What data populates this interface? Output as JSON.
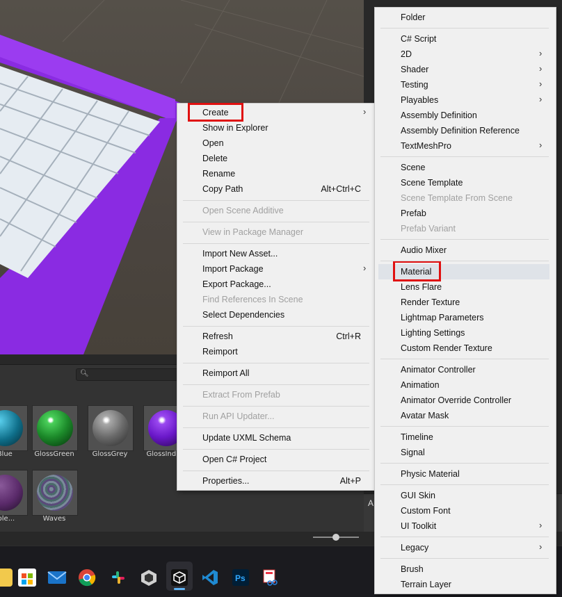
{
  "context_menu": {
    "items": [
      {
        "label": "Create",
        "shortcut": "",
        "submenu": true,
        "enabled": true
      },
      {
        "label": "Show in Explorer",
        "shortcut": "",
        "submenu": false,
        "enabled": true
      },
      {
        "label": "Open",
        "shortcut": "",
        "submenu": false,
        "enabled": true
      },
      {
        "label": "Delete",
        "shortcut": "",
        "submenu": false,
        "enabled": true
      },
      {
        "label": "Rename",
        "shortcut": "",
        "submenu": false,
        "enabled": true
      },
      {
        "label": "Copy Path",
        "shortcut": "Alt+Ctrl+C",
        "submenu": false,
        "enabled": true
      },
      {
        "label": "Open Scene Additive",
        "shortcut": "",
        "submenu": false,
        "enabled": false
      },
      {
        "label": "View in Package Manager",
        "shortcut": "",
        "submenu": false,
        "enabled": false
      },
      {
        "label": "Import New Asset...",
        "shortcut": "",
        "submenu": false,
        "enabled": true
      },
      {
        "label": "Import Package",
        "shortcut": "",
        "submenu": true,
        "enabled": true
      },
      {
        "label": "Export Package...",
        "shortcut": "",
        "submenu": false,
        "enabled": true
      },
      {
        "label": "Find References In Scene",
        "shortcut": "",
        "submenu": false,
        "enabled": false
      },
      {
        "label": "Select Dependencies",
        "shortcut": "",
        "submenu": false,
        "enabled": true
      },
      {
        "label": "Refresh",
        "shortcut": "Ctrl+R",
        "submenu": false,
        "enabled": true
      },
      {
        "label": "Reimport",
        "shortcut": "",
        "submenu": false,
        "enabled": true
      },
      {
        "label": "Reimport All",
        "shortcut": "",
        "submenu": false,
        "enabled": true
      },
      {
        "label": "Extract From Prefab",
        "shortcut": "",
        "submenu": false,
        "enabled": false
      },
      {
        "label": "Run API Updater...",
        "shortcut": "",
        "submenu": false,
        "enabled": false
      },
      {
        "label": "Update UXML Schema",
        "shortcut": "",
        "submenu": false,
        "enabled": true
      },
      {
        "label": "Open C# Project",
        "shortcut": "",
        "submenu": false,
        "enabled": true
      },
      {
        "label": "Properties...",
        "shortcut": "Alt+P",
        "submenu": false,
        "enabled": true
      }
    ]
  },
  "create_submenu": {
    "items": [
      {
        "label": "Folder",
        "submenu": false,
        "enabled": true
      },
      {
        "label": "C# Script",
        "submenu": false,
        "enabled": true
      },
      {
        "label": "2D",
        "submenu": true,
        "enabled": true
      },
      {
        "label": "Shader",
        "submenu": true,
        "enabled": true
      },
      {
        "label": "Testing",
        "submenu": true,
        "enabled": true
      },
      {
        "label": "Playables",
        "submenu": true,
        "enabled": true
      },
      {
        "label": "Assembly Definition",
        "submenu": false,
        "enabled": true
      },
      {
        "label": "Assembly Definition Reference",
        "submenu": false,
        "enabled": true
      },
      {
        "label": "TextMeshPro",
        "submenu": true,
        "enabled": true
      },
      {
        "label": "Scene",
        "submenu": false,
        "enabled": true
      },
      {
        "label": "Scene Template",
        "submenu": false,
        "enabled": true
      },
      {
        "label": "Scene Template From Scene",
        "submenu": false,
        "enabled": false
      },
      {
        "label": "Prefab",
        "submenu": false,
        "enabled": true
      },
      {
        "label": "Prefab Variant",
        "submenu": false,
        "enabled": false
      },
      {
        "label": "Audio Mixer",
        "submenu": false,
        "enabled": true
      },
      {
        "label": "Material",
        "submenu": false,
        "enabled": true
      },
      {
        "label": "Lens Flare",
        "submenu": false,
        "enabled": true
      },
      {
        "label": "Render Texture",
        "submenu": false,
        "enabled": true
      },
      {
        "label": "Lightmap Parameters",
        "submenu": false,
        "enabled": true
      },
      {
        "label": "Lighting Settings",
        "submenu": false,
        "enabled": true
      },
      {
        "label": "Custom Render Texture",
        "submenu": false,
        "enabled": true
      },
      {
        "label": "Animator Controller",
        "submenu": false,
        "enabled": true
      },
      {
        "label": "Animation",
        "submenu": false,
        "enabled": true
      },
      {
        "label": "Animator Override Controller",
        "submenu": false,
        "enabled": true
      },
      {
        "label": "Avatar Mask",
        "submenu": false,
        "enabled": true
      },
      {
        "label": "Timeline",
        "submenu": false,
        "enabled": true
      },
      {
        "label": "Signal",
        "submenu": false,
        "enabled": true
      },
      {
        "label": "Physic Material",
        "submenu": false,
        "enabled": true
      },
      {
        "label": "GUI Skin",
        "submenu": false,
        "enabled": true
      },
      {
        "label": "Custom Font",
        "submenu": false,
        "enabled": true
      },
      {
        "label": "UI Toolkit",
        "submenu": true,
        "enabled": true
      },
      {
        "label": "Legacy",
        "submenu": true,
        "enabled": true
      },
      {
        "label": "Brush",
        "submenu": false,
        "enabled": true
      },
      {
        "label": "Terrain Layer",
        "submenu": false,
        "enabled": true
      }
    ]
  },
  "project_assets": [
    {
      "label": "...Blue",
      "color": "#0f6f8a"
    },
    {
      "label": "GlossGreen",
      "color": "#1c8a2a"
    },
    {
      "label": "GlossGrey",
      "color": "#8a8a8a"
    },
    {
      "label": "GlossIndi...",
      "color": "#6a18c9"
    },
    {
      "label": "...rple...",
      "color": "#5a2a6a"
    },
    {
      "label": "Waves",
      "color": "#6a7a8a"
    }
  ],
  "right_dock_letters": {
    "top": "A",
    "bottom": "As"
  },
  "taskbar": {
    "icons": [
      "file-explorer-icon",
      "microsoft-store-icon",
      "mail-icon",
      "chrome-icon",
      "slack-icon",
      "unity-hub-icon",
      "unity-editor-icon",
      "vscode-icon",
      "photoshop-icon",
      "snipping-tool-icon"
    ],
    "active": "unity-editor-icon"
  },
  "accent_colors": {
    "highlight_box": "#e01010",
    "platform_border": "#8a2be2",
    "taskbar_active": "#5fb2f2"
  }
}
